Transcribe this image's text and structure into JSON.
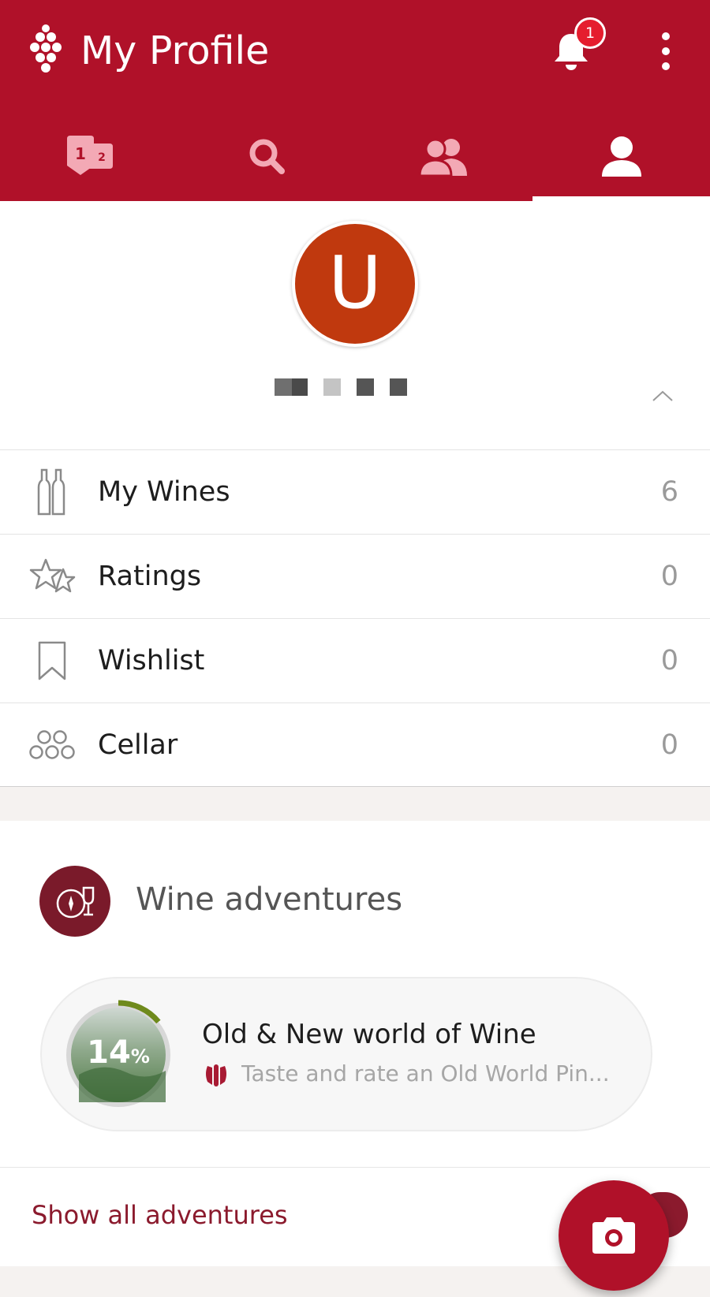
{
  "appbar": {
    "title": "My Profile",
    "notification_count": "1",
    "background_color": "#b01129",
    "icons": [
      "grape-logo-icon",
      "bell-icon",
      "more-vert-icon"
    ]
  },
  "tabs": [
    {
      "name": "rankings",
      "icon": "rankings-icon",
      "selected": false
    },
    {
      "name": "search",
      "icon": "search-icon",
      "selected": false
    },
    {
      "name": "friends",
      "icon": "friends-icon",
      "selected": false
    },
    {
      "name": "profile",
      "icon": "profile-icon",
      "selected": true
    }
  ],
  "profile": {
    "avatar_initial": "U",
    "avatar_color": "#c0390e"
  },
  "stats": [
    {
      "label": "My Wines",
      "count": "6",
      "icon": "bottles-icon"
    },
    {
      "label": "Ratings",
      "count": "0",
      "icon": "stars-icon"
    },
    {
      "label": "Wishlist",
      "count": "0",
      "icon": "bookmark-icon"
    },
    {
      "label": "Cellar",
      "count": "0",
      "icon": "cellar-icon"
    }
  ],
  "adventures": {
    "title": "Wine adventures",
    "item": {
      "progress_value": "14",
      "progress_unit": "%",
      "progress_fraction": 0.14,
      "title": "Old & New world of Wine",
      "subtitle": "Taste and rate an Old World Pin..."
    },
    "show_all": "Show all adventures"
  },
  "fab": {
    "icon": "camera-icon"
  }
}
